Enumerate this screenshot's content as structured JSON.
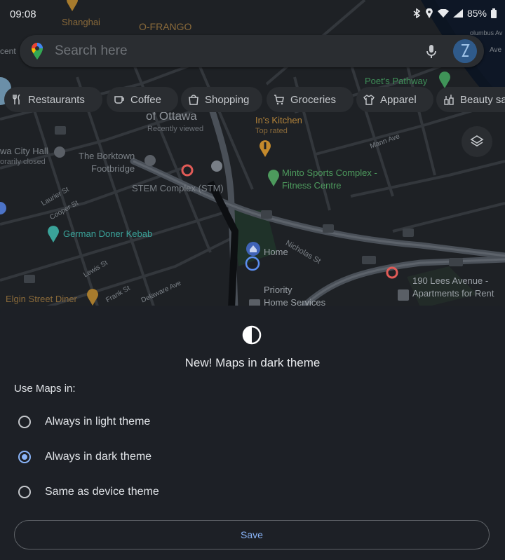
{
  "status": {
    "time": "09:08",
    "battery": "85%"
  },
  "search": {
    "placeholder": "Search here"
  },
  "chips": [
    {
      "label": "Restaurants",
      "icon": "fork-knife-icon"
    },
    {
      "label": "Coffee",
      "icon": "coffee-cup-icon"
    },
    {
      "label": "Shopping",
      "icon": "shopping-bag-icon"
    },
    {
      "label": "Groceries",
      "icon": "shopping-cart-icon"
    },
    {
      "label": "Apparel",
      "icon": "shirt-icon"
    },
    {
      "label": "Beauty sa",
      "icon": "beauty-icon"
    }
  ],
  "map_labels": {
    "shanghai": "Shanghai",
    "frango": "O-FRANGO",
    "poets": "Poet's Pathway",
    "ottawa": "of Ottawa",
    "recently": "Recently viewed",
    "kitchen": "In's Kitchen",
    "toprated": "Top rated",
    "cityhall": "wa City Hall",
    "temporarily": "orarily closed",
    "borktown": "The Borktown",
    "footbridge": "Footbridge",
    "stem": "STEM Complex (STM)",
    "minto": "Minto Sports Complex -",
    "fitness": "Fitness Centre",
    "doner": "German Doner Kebab",
    "home": "Home",
    "nicholas": "Nicholas St",
    "lees": "190 Lees Avenue -",
    "apartments": "Apartments for Rent",
    "priority": "Priority",
    "homeservices": "Home Services",
    "elgin": "Elgin Street Diner",
    "mann": "Mann Ave",
    "laurier": "Laurier St",
    "cooper": "Cooper St",
    "lewis": "Lewis St",
    "frank": "Frank St",
    "delaware": "Delaware Ave",
    "cent": "cent",
    "olumbus": "olumbus Av",
    "ave": "Ave"
  },
  "sheet": {
    "title": "New! Maps in dark theme",
    "use_label": "Use Maps in:",
    "options": [
      {
        "label": "Always in light theme",
        "selected": false
      },
      {
        "label": "Always in dark theme",
        "selected": true
      },
      {
        "label": "Same as device theme",
        "selected": false
      }
    ],
    "save_label": "Save"
  },
  "colors": {
    "accent": "#8ab4f8",
    "sheet_bg": "#1d2026",
    "map_bg": "#1e2125"
  }
}
